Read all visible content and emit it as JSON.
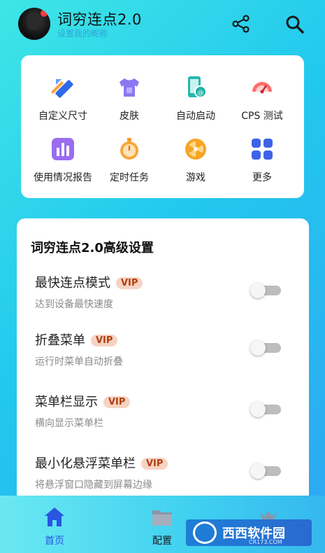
{
  "header": {
    "title": "词穷连点2.0",
    "subtitle": "设置我的昵称",
    "share_icon": "share-icon",
    "search_icon": "search-icon"
  },
  "tools": [
    {
      "label": "自定义尺寸",
      "icon": "ruler-pencil-icon"
    },
    {
      "label": "皮肤",
      "icon": "tshirt-icon"
    },
    {
      "label": "自动启动",
      "icon": "phone-auto-icon"
    },
    {
      "label": "CPS 测试",
      "icon": "speedometer-icon"
    },
    {
      "label": "使用情况报告",
      "icon": "bar-chart-icon"
    },
    {
      "label": "定时任务",
      "icon": "stopwatch-icon"
    },
    {
      "label": "游戏",
      "icon": "wheel-icon"
    },
    {
      "label": "更多",
      "icon": "grid-icon"
    }
  ],
  "settings": {
    "title": "词穷连点2.0高级设置",
    "vip_label": "VIP",
    "items": [
      {
        "name": "最快连点模式",
        "desc": "达到设备最快速度",
        "vip": true,
        "on": false
      },
      {
        "name": "折叠菜单",
        "desc": "运行时菜单自动折叠",
        "vip": true,
        "on": false
      },
      {
        "name": "菜单栏显示",
        "desc": "横向显示菜单栏",
        "vip": true,
        "on": false
      },
      {
        "name": "最小化悬浮菜单栏",
        "desc": "将悬浮窗口隐藏到屏幕边缘",
        "vip": true,
        "on": false
      }
    ]
  },
  "nav": {
    "items": [
      {
        "label": "首页",
        "icon": "home-icon",
        "active": true
      },
      {
        "label": "配置",
        "icon": "folder-icon",
        "active": false
      },
      {
        "label": "",
        "icon": "vip-icon",
        "active": false
      }
    ]
  },
  "watermark": {
    "text": "西西软件园",
    "sub": "CR173.COM"
  },
  "colors": {
    "accent": "#2a55e0",
    "vip_bg": "#f6d3c3",
    "vip_text": "#b04010"
  }
}
